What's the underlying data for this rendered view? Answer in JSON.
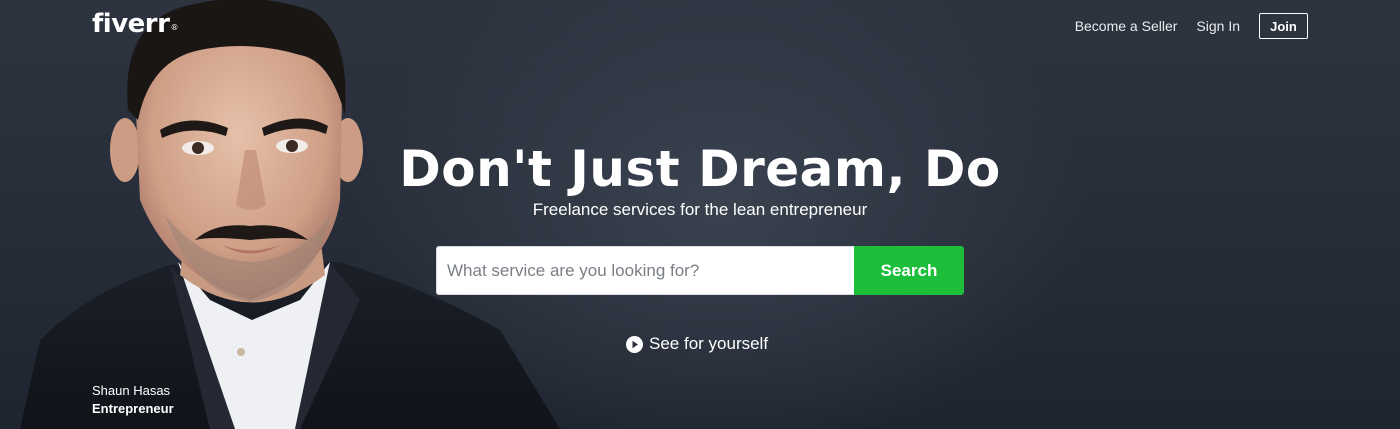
{
  "header": {
    "logo_text": "fiverr",
    "logo_reg": "®",
    "nav": {
      "become_seller": "Become a Seller",
      "sign_in": "Sign In",
      "join": "Join"
    }
  },
  "hero": {
    "headline": "Don't Just Dream, Do",
    "subheadline": "Freelance services for the lean entrepreneur",
    "search": {
      "placeholder": "What service are you looking for?",
      "value": "",
      "button_label": "Search"
    },
    "video_link": {
      "icon": "play-circle-icon",
      "label": "See for yourself"
    }
  },
  "featured_person": {
    "name": "Shaun Hasas",
    "role": "Entrepreneur"
  },
  "colors": {
    "background": "#2a303b",
    "search_button": "#1dbf3a",
    "text": "#ffffff"
  }
}
